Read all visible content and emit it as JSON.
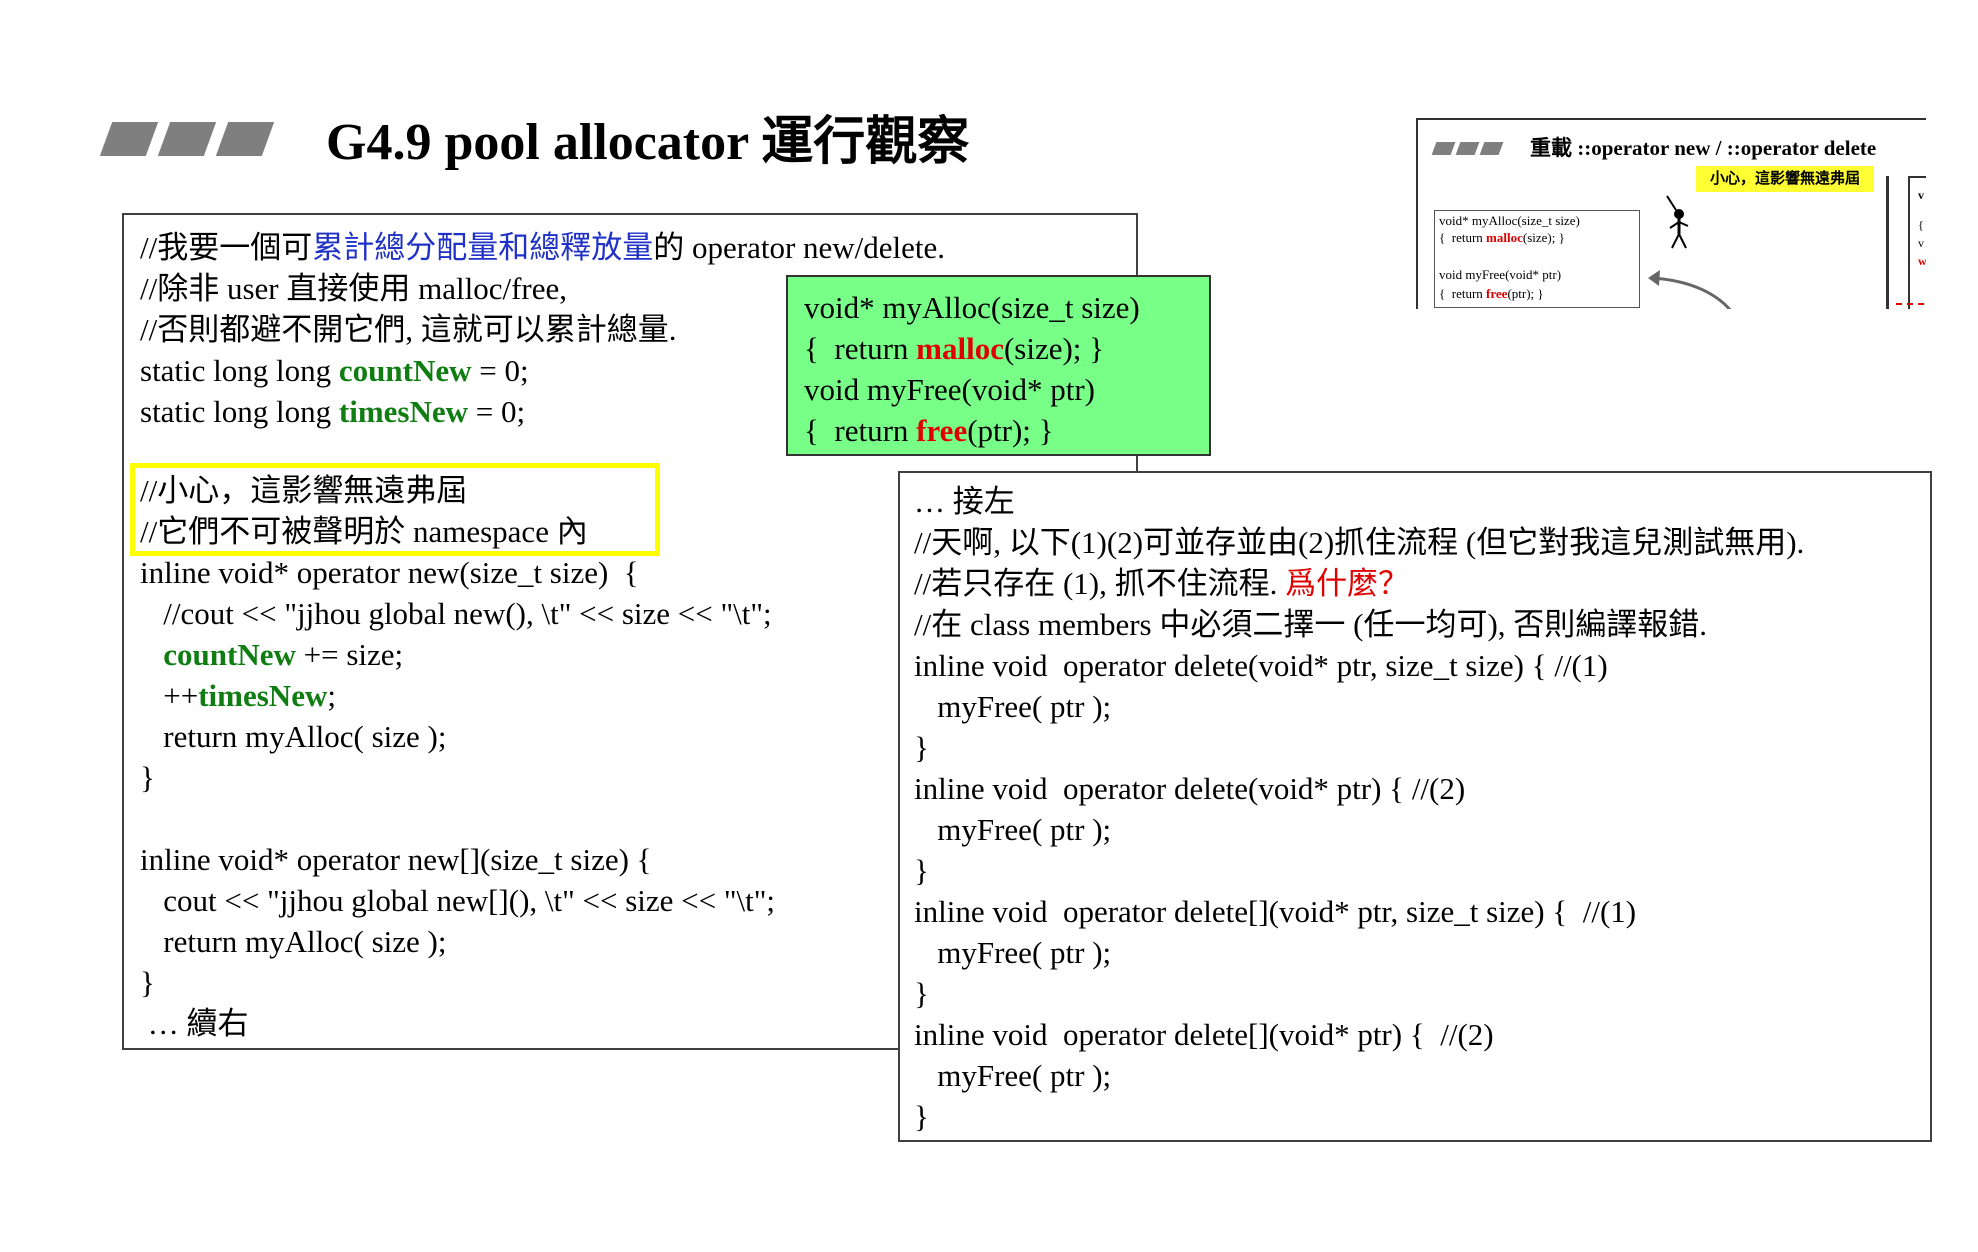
{
  "slide": {
    "title": "G4.9 pool allocator 運行觀察"
  },
  "thumbnail": {
    "title": "重載 ::operator new / ::operator delete",
    "note": "小心，這影響無遠弗屆",
    "lines": [
      [
        "void* myAlloc(size_t size)"
      ],
      [
        "{  return ",
        "malloc",
        "(size); }"
      ],
      [
        "void myFree(void* ptr)"
      ],
      [
        "{  return ",
        "free",
        "(ptr); }"
      ]
    ],
    "edge_text": [
      "v",
      "{",
      "v",
      "w"
    ]
  },
  "green_box": {
    "lines": [
      [
        "void* myAlloc(size_t size)"
      ],
      [
        "{  return ",
        "malloc",
        "(size); }"
      ],
      [
        "void myFree(void* ptr)"
      ],
      [
        "{  return ",
        "free",
        "(ptr); }"
      ]
    ]
  },
  "left_box": {
    "comment1_pre": "//我要一個可",
    "comment1_blue": "累計總分配量和總釋放量",
    "comment1_post": "的 operator new/delete.",
    "comment2": "//除非 user 直接使用 malloc/free,",
    "comment3": "//否則都避不開它們, 這就可以累計總量.",
    "decl1_pre": "static long long ",
    "decl1_var": "countNew",
    "decl1_post": " = 0;",
    "decl2_pre": "static long long ",
    "decl2_var": "timesNew",
    "decl2_post": " = 0;",
    "warn1": "//小心，這影響無遠弗屆",
    "warn2": "//它們不可被聲明於 namespace 內",
    "new_sig": "inline void* operator new(size_t size)  {",
    "new_cout": "   //cout << \"jjhou global new(), \\t\" << size << \"\\t\";",
    "new_count_var": "countNew",
    "new_count_post": " += size;",
    "new_times_pre": "++",
    "new_times_var": "timesNew",
    "new_times_post": ";",
    "new_ret": "   return myAlloc( size );",
    "close1": "}",
    "newarr_sig": "inline void* operator new[](size_t size) {",
    "newarr_cout": "   cout << \"jjhou global new[](), \\t\" << size << \"\\t\";",
    "newarr_ret": "   return myAlloc( size );",
    "close2": "}",
    "continue": " … 續右"
  },
  "right_box": {
    "head": "… 接左",
    "c1": "//天啊, 以下(1)(2)可並存並由(2)抓住流程 (但它對我這兒測試無用).",
    "c2_pre": "//若只存在 (1), 抓不住流程. ",
    "c2_red": "爲什麼？",
    "c3": "//在 class members 中必須二擇一 (任一均可), 否則編譯報錯.",
    "d1": "inline void  operator delete(void* ptr, size_t size) { //(1)",
    "d1_body": "   myFree( ptr );",
    "d1_close": "}",
    "d2": "inline void  operator delete(void* ptr) { //(2)",
    "d2_body": "   myFree( ptr );",
    "d2_close": "}",
    "d3": "inline void  operator delete[](void* ptr, size_t size) {  //(1)",
    "d3_body": "   myFree( ptr );",
    "d3_close": "}",
    "d4": "inline void  operator delete[](void* ptr) {  //(2)",
    "d4_body": "   myFree( ptr );",
    "d4_close": "}"
  }
}
